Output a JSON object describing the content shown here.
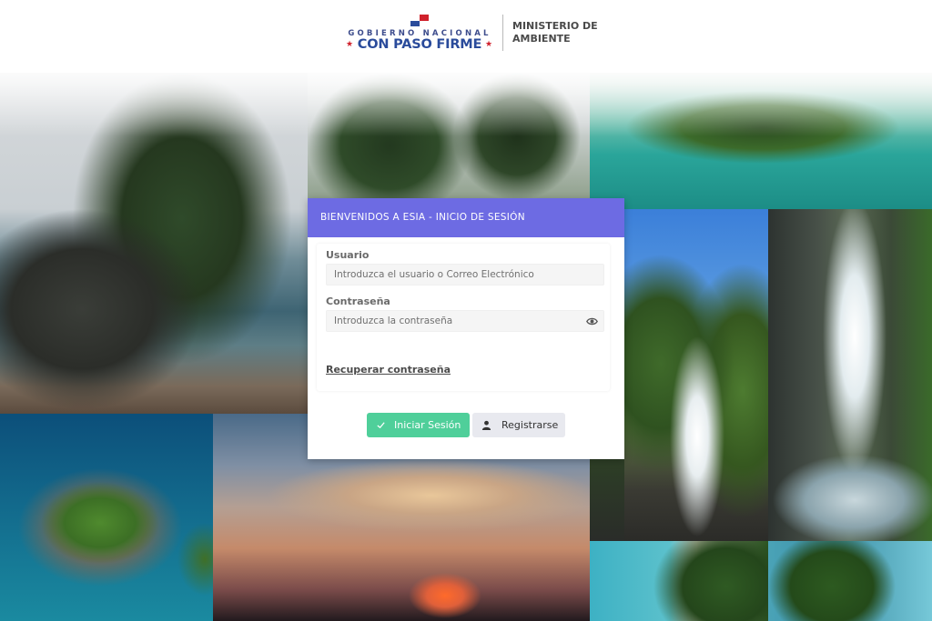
{
  "header": {
    "brand_top": "GOBIERNO NACIONAL",
    "brand_main": "CON PASO FIRME",
    "ministry_line1": "MINISTERIO DE",
    "ministry_line2": "AMBIENTE"
  },
  "login": {
    "title": "BIENVENIDOS A ESIA - INICIO DE SESIÓN",
    "user_label": "Usuario",
    "user_placeholder": "Introduzca el usuario o Correo Electrónico",
    "password_label": "Contraseña",
    "password_placeholder": "Introduzca la contraseña",
    "recover_link": "Recuperar contraseña",
    "login_button": "Iniciar Sesión",
    "register_button": "Registrarse"
  },
  "icons": {
    "password_toggle": "eye-icon",
    "login": "check-icon",
    "register": "user-icon"
  },
  "colors": {
    "header_bar": "#6d6be3",
    "login_button": "#4fcf9a",
    "register_button": "#e8e9ef",
    "brand_blue": "#2a4b9b",
    "brand_red": "#d0212c"
  }
}
